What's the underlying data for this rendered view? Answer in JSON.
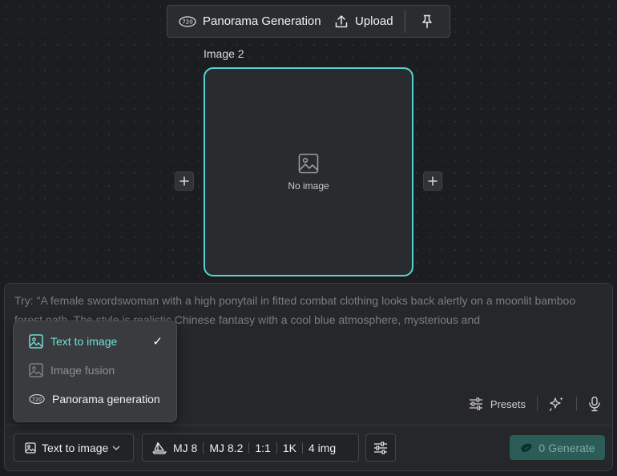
{
  "toolbar": {
    "panorama_label": "Panorama Generation",
    "upload_label": "Upload"
  },
  "node": {
    "title": "Image 2",
    "empty_text": "No image",
    "accent_color": "#57d3d0"
  },
  "prompt": {
    "placeholder": "Try: \"A female swordswoman with a high ponytail in fitted combat clothing looks back alertly on a moonlit bamboo forest path. The style is realistic Chinese fantasy with a cool blue atmosphere, mysterious and"
  },
  "tools": {
    "presets_label": "Presets"
  },
  "bottom": {
    "mode_label": "Text to image",
    "models": [
      "MJ 8",
      "MJ 8.2",
      "1:1",
      "1K",
      "4 img"
    ],
    "generate_count": "0",
    "generate_label": "Generate"
  },
  "dropdown": {
    "items": [
      {
        "label": "Text to image",
        "state": "selected",
        "icon": "image-icon"
      },
      {
        "label": "Image fusion",
        "state": "disabled",
        "icon": "image-icon"
      },
      {
        "label": "Panorama generation",
        "state": "normal",
        "icon": "panorama-720-icon"
      }
    ],
    "check_mark": "✓",
    "active_color": "#6fe0d8"
  },
  "icons": {
    "panorama": "720",
    "upload": "upload-icon",
    "pin": "pin-icon",
    "placeholder": "image-placeholder-icon",
    "add": "plus-icon",
    "presets": "sliders-icon",
    "magic": "sparkle-icon",
    "mic": "microphone-icon",
    "model": "sailboat-icon",
    "settings": "settings-sliders-icon",
    "generate": "bean-icon"
  }
}
